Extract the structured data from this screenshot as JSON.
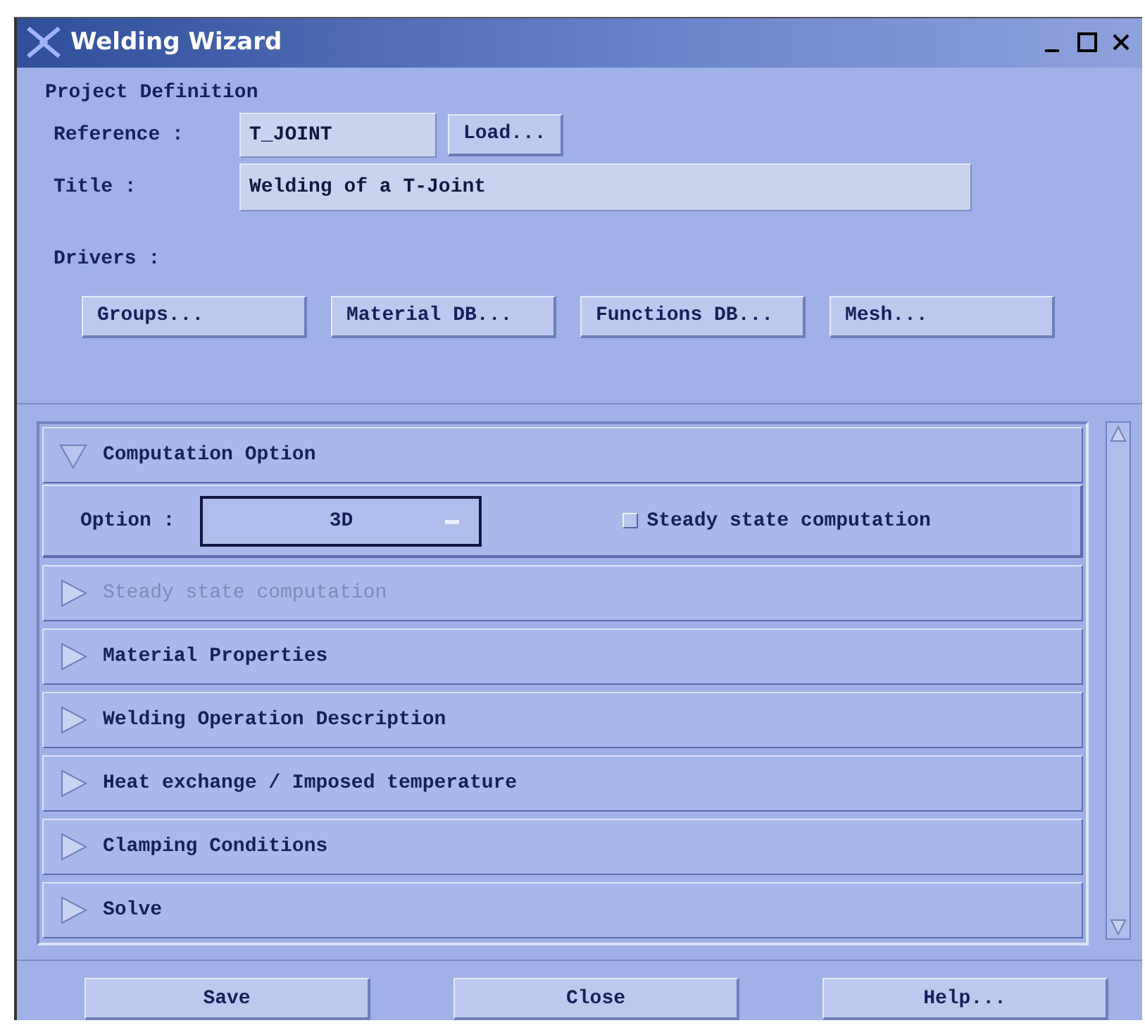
{
  "window": {
    "title": "Welding Wizard"
  },
  "project": {
    "heading": "Project Definition",
    "reference_label": "Reference :",
    "reference_value": "T_JOINT",
    "load_button": "Load...",
    "title_label": "Title :",
    "title_value": "Welding of a T-Joint",
    "drivers_label": "Drivers :",
    "driver_buttons": [
      "Groups...",
      "Material DB...",
      "Functions DB...",
      "Mesh..."
    ]
  },
  "sections": [
    {
      "title": "Computation Option",
      "expanded": true,
      "disabled": false,
      "option_label": "Option :",
      "option_value": "3D",
      "checkbox": {
        "label": "Steady state computation",
        "checked": false
      }
    },
    {
      "title": "Steady state computation",
      "expanded": false,
      "disabled": true
    },
    {
      "title": "Material Properties",
      "expanded": false,
      "disabled": false
    },
    {
      "title": "Welding Operation Description",
      "expanded": false,
      "disabled": false
    },
    {
      "title": "Heat exchange / Imposed temperature",
      "expanded": false,
      "disabled": false
    },
    {
      "title": "Clamping Conditions",
      "expanded": false,
      "disabled": false
    },
    {
      "title": "Solve",
      "expanded": false,
      "disabled": false
    }
  ],
  "buttons": [
    "Save",
    "Close",
    "Help..."
  ]
}
